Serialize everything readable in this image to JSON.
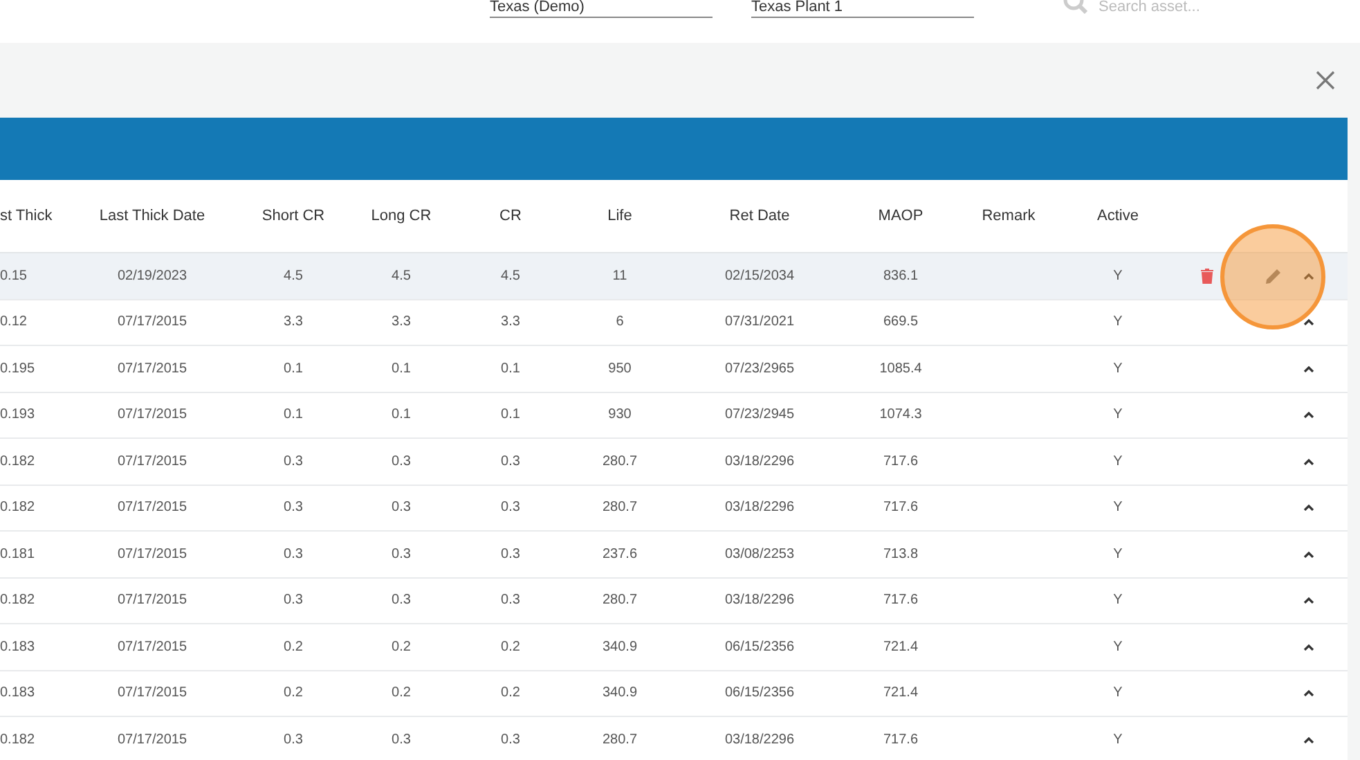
{
  "filters": [
    {
      "value": "Texas (Demo)"
    },
    {
      "value": "Texas Plant 1"
    }
  ],
  "search": {
    "placeholder": "Search asset..."
  },
  "table": {
    "columns": [
      "st Thick",
      "Last Thick Date",
      "Short CR",
      "Long CR",
      "CR",
      "Life",
      "Ret Date",
      "MAOP",
      "Remark",
      "Active"
    ],
    "rows": [
      {
        "selected": true,
        "cells": [
          "0.15",
          "02/19/2023",
          "4.5",
          "4.5",
          "4.5",
          "11",
          "02/15/2034",
          "836.1",
          "",
          "Y"
        ]
      },
      {
        "selected": false,
        "cells": [
          "0.12",
          "07/17/2015",
          "3.3",
          "3.3",
          "3.3",
          "6",
          "07/31/2021",
          "669.5",
          "",
          "Y"
        ]
      },
      {
        "selected": false,
        "cells": [
          "0.195",
          "07/17/2015",
          "0.1",
          "0.1",
          "0.1",
          "950",
          "07/23/2965",
          "1085.4",
          "",
          "Y"
        ]
      },
      {
        "selected": false,
        "cells": [
          "0.193",
          "07/17/2015",
          "0.1",
          "0.1",
          "0.1",
          "930",
          "07/23/2945",
          "1074.3",
          "",
          "Y"
        ]
      },
      {
        "selected": false,
        "cells": [
          "0.182",
          "07/17/2015",
          "0.3",
          "0.3",
          "0.3",
          "280.7",
          "03/18/2296",
          "717.6",
          "",
          "Y"
        ]
      },
      {
        "selected": false,
        "cells": [
          "0.182",
          "07/17/2015",
          "0.3",
          "0.3",
          "0.3",
          "280.7",
          "03/18/2296",
          "717.6",
          "",
          "Y"
        ]
      },
      {
        "selected": false,
        "cells": [
          "0.181",
          "07/17/2015",
          "0.3",
          "0.3",
          "0.3",
          "237.6",
          "03/08/2253",
          "713.8",
          "",
          "Y"
        ]
      },
      {
        "selected": false,
        "cells": [
          "0.182",
          "07/17/2015",
          "0.3",
          "0.3",
          "0.3",
          "280.7",
          "03/18/2296",
          "717.6",
          "",
          "Y"
        ]
      },
      {
        "selected": false,
        "cells": [
          "0.183",
          "07/17/2015",
          "0.2",
          "0.2",
          "0.2",
          "340.9",
          "06/15/2356",
          "721.4",
          "",
          "Y"
        ]
      },
      {
        "selected": false,
        "cells": [
          "0.183",
          "07/17/2015",
          "0.2",
          "0.2",
          "0.2",
          "340.9",
          "06/15/2356",
          "721.4",
          "",
          "Y"
        ]
      },
      {
        "selected": false,
        "cells": [
          "0.182",
          "07/17/2015",
          "0.3",
          "0.3",
          "0.3",
          "280.7",
          "03/18/2296",
          "717.6",
          "",
          "Y"
        ]
      }
    ]
  }
}
